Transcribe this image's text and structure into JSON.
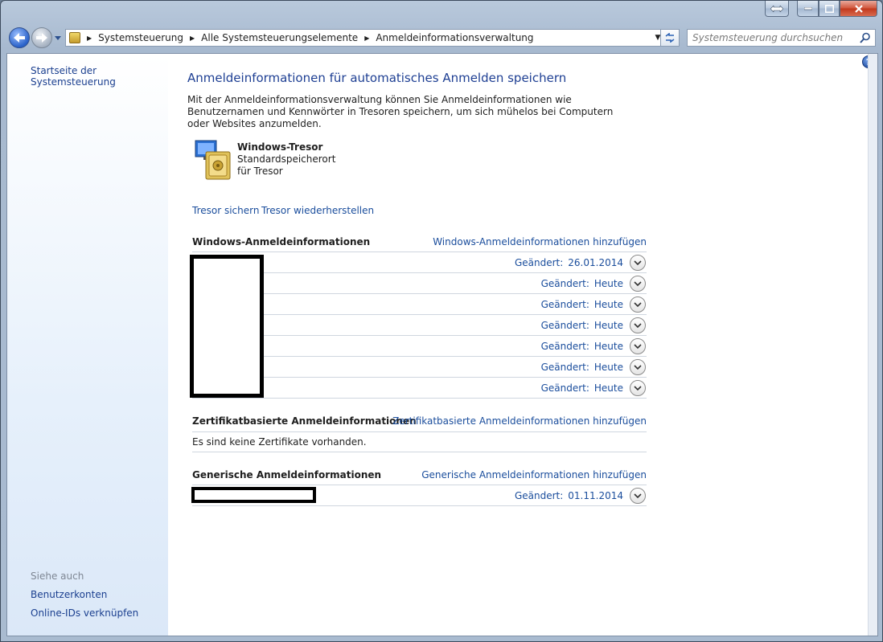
{
  "window": {
    "caption_buttons": [
      "resize",
      "minimize",
      "maximize",
      "close"
    ]
  },
  "nav": {
    "breadcrumbs": [
      "Systemsteuerung",
      "Alle Systemsteuerungselemente",
      "Anmeldeinformationsverwaltung"
    ],
    "search_placeholder": "Systemsteuerung durchsuchen"
  },
  "sidebar": {
    "home": "Startseite der Systemsteuerung",
    "see_also": "Siehe auch",
    "links": [
      "Benutzerkonten",
      "Online-IDs verknüpfen"
    ]
  },
  "main": {
    "title": "Anmeldeinformationen für automatisches Anmelden speichern",
    "intro": "Mit der Anmeldeinformationsverwaltung können Sie Anmeldeinformationen wie Benutzernamen und Kennwörter in Tresoren speichern, um sich mühelos bei Computern oder Websites anzumelden.",
    "vault": {
      "title": "Windows-Tresor",
      "line1": "Standardspeicherort",
      "line2": "für Tresor"
    },
    "backup": "Tresor sichern",
    "restore": "Tresor wiederherstellen"
  },
  "windows_credentials": {
    "title": "Windows-Anmeldeinformationen",
    "add": "Windows-Anmeldeinformationen hinzufügen",
    "rows": [
      {
        "label": "Geändert:",
        "value": "26.01.2014"
      },
      {
        "label": "Geändert:",
        "value": "Heute"
      },
      {
        "label": "Geändert:",
        "value": "Heute"
      },
      {
        "label": "Geändert:",
        "value": "Heute"
      },
      {
        "label": "Geändert:",
        "value": "Heute"
      },
      {
        "label": "Geändert:",
        "value": "Heute"
      },
      {
        "label": "Geändert:",
        "value": "Heute"
      }
    ]
  },
  "cert_credentials": {
    "title": "Zertifikatbasierte Anmeldeinformationen",
    "add": "Zertifikatbasierte Anmeldeinformationen hinzufügen",
    "empty": "Es sind keine Zertifikate vorhanden."
  },
  "generic_credentials": {
    "title": "Generische Anmeldeinformationen",
    "add": "Generische Anmeldeinformationen hinzufügen",
    "rows": [
      {
        "label": "Geändert:",
        "value": "01.11.2014"
      }
    ]
  },
  "colors": {
    "link": "#1a4d9c",
    "title": "#1e3f93",
    "sidebar_bg": "#dbe8f8"
  }
}
